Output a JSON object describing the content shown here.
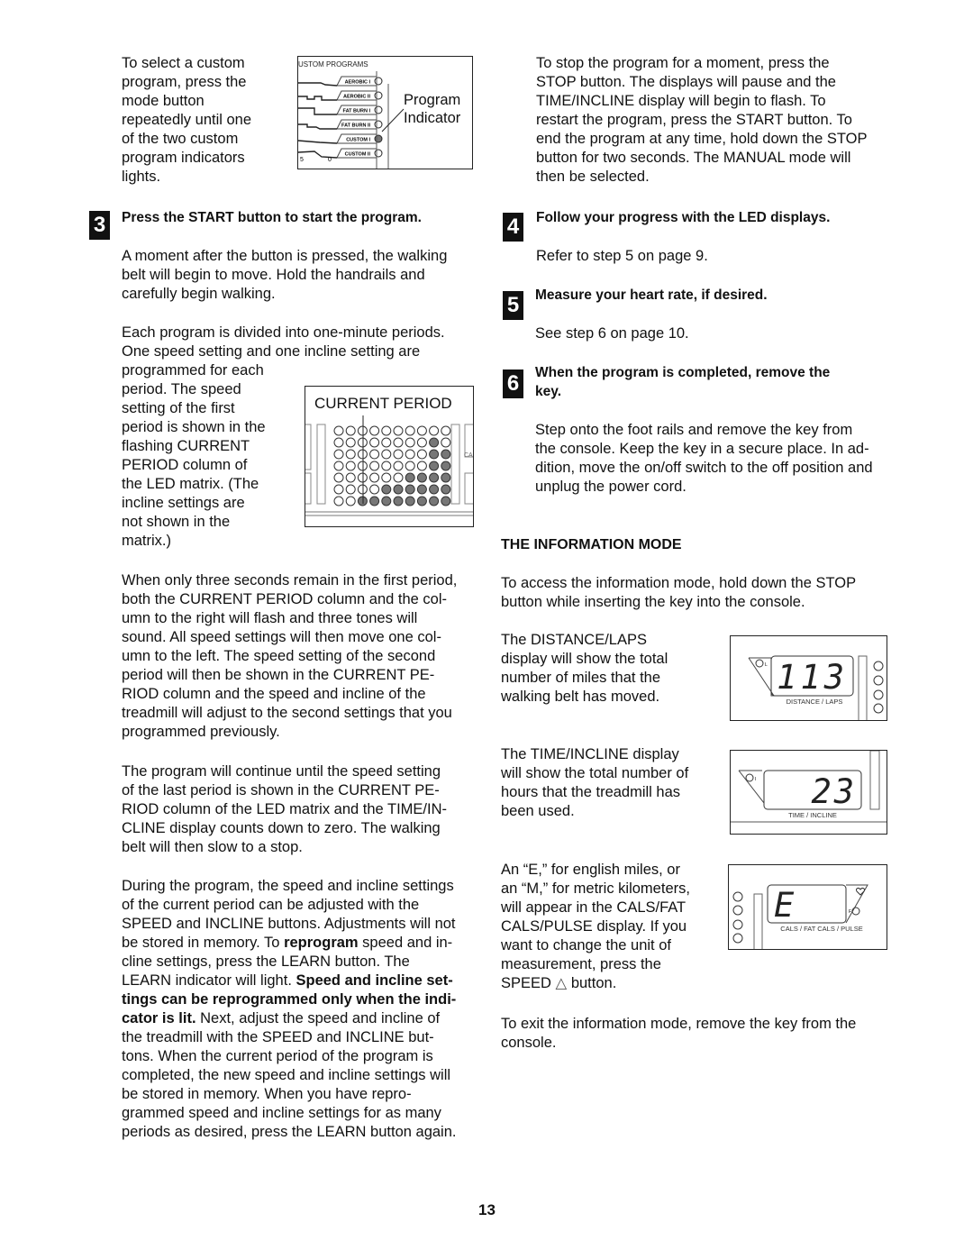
{
  "page": {
    "page_number": "13"
  },
  "left_column": {
    "custom_select_text": "To select a custom program, press the mode button repeatedly until one of the two custom program indicators lights.",
    "custom_select_lines": [
      "To select a custom",
      "program, press the",
      "mode button",
      "repeatedly until one",
      "of the two custom",
      "program indicators",
      "lights."
    ],
    "program_figure": {
      "header": "USTOM PROGRAMS",
      "programs": [
        "AEROBIC I",
        "AEROBIC II",
        "FAT BURN I",
        "FAT BURN II",
        "CUSTOM I",
        "CUSTOM II"
      ],
      "lit_program": "CUSTOM I",
      "callout_line1": "Program",
      "callout_line2": "Indicator",
      "bottom_ticks": [
        "5",
        "0"
      ]
    },
    "step3": {
      "number": "3",
      "title": "Press the START button to start the program.",
      "para1_lines": [
        "A moment after the button is pressed, the walking",
        "belt will begin to move. Hold the handrails and",
        "carefully begin walking."
      ],
      "para2_full_lines": [
        "Each program is divided into one-minute periods.",
        "One speed setting and one incline setting are"
      ],
      "para2_wrap_lines": [
        "programmed for each",
        "period. The speed",
        "setting of the first",
        "period is shown in the",
        "flashing CURRENT",
        "PERIOD column of",
        "the LED matrix. (The",
        "incline settings are",
        "not shown in the",
        "matrix.)"
      ],
      "matrix_figure": {
        "label": "CURRENT PERIOD",
        "side_label": "CA",
        "rows": 7,
        "cols": 10,
        "current_column": 3,
        "filled_heights_by_column": [
          0,
          0,
          1,
          1,
          2,
          2,
          3,
          3,
          6,
          5
        ]
      },
      "para3_lines": [
        "When only three seconds remain in the first period,",
        "both the CURRENT PERIOD column and the col-",
        "umn to the right will flash and three tones will",
        "sound. All speed settings will then move one col-",
        "umn to the left. The speed setting of the second",
        "period will then be shown in the CURRENT PE-",
        "RIOD column and the speed and incline of the",
        "treadmill will adjust to the second settings that you",
        "programmed previously."
      ],
      "para4_lines": [
        "The program will continue until the speed setting",
        "of the last period is shown in the CURRENT PE-",
        "RIOD column of the LED matrix and the TIME/IN-",
        "CLINE display counts down to zero. The walking",
        "belt will then slow to a stop."
      ],
      "para5_lines": [
        {
          "parts": [
            {
              "t": "During the program, the speed and incline settings"
            }
          ]
        },
        {
          "parts": [
            {
              "t": "of the current period can be adjusted with the"
            }
          ]
        },
        {
          "parts": [
            {
              "t": "SPEED and INCLINE buttons. Adjustments will not"
            }
          ]
        },
        {
          "parts": [
            {
              "t": "be stored in memory. To "
            },
            {
              "t": "reprogram",
              "b": true
            },
            {
              "t": " speed and in-"
            }
          ]
        },
        {
          "parts": [
            {
              "t": "cline settings, press the LEARN button. The"
            }
          ]
        },
        {
          "parts": [
            {
              "t": "LEARN indicator will light. "
            },
            {
              "t": "Speed and incline set-",
              "b": true
            }
          ]
        },
        {
          "parts": [
            {
              "t": "tings can be reprogrammed only when the indi-",
              "b": true
            }
          ]
        },
        {
          "parts": [
            {
              "t": "cator is lit.",
              "b": true
            },
            {
              "t": " Next, adjust the speed and incline of"
            }
          ]
        },
        {
          "parts": [
            {
              "t": "the treadmill with the SPEED and INCLINE but-"
            }
          ]
        },
        {
          "parts": [
            {
              "t": "tons. When the current period of the program is"
            }
          ]
        },
        {
          "parts": [
            {
              "t": "completed, the new speed and incline settings will"
            }
          ]
        },
        {
          "parts": [
            {
              "t": "be stored in memory. When you have repro-"
            }
          ]
        },
        {
          "parts": [
            {
              "t": "grammed speed and incline settings for as many"
            }
          ]
        },
        {
          "parts": [
            {
              "t": "periods as desired, press the LEARN button again."
            }
          ]
        }
      ]
    }
  },
  "right_column": {
    "stop_para_lines": [
      "To stop the program for a moment, press the",
      "STOP button. The displays will pause and the",
      "TIME/INCLINE display will begin to flash. To",
      "restart the program, press the START button. To",
      "end the program at any time, hold down the STOP",
      "button for two seconds. The MANUAL mode will",
      "then be selected."
    ],
    "step4": {
      "number": "4",
      "title": "Follow your progress with the LED displays.",
      "body": "Refer to step 5 on page 9."
    },
    "step5": {
      "number": "5",
      "title": "Measure your heart rate, if desired.",
      "body": "See step 6 on page 10."
    },
    "step6": {
      "number": "6",
      "title_line1": "When the program is completed, remove the",
      "title_line2": "key.",
      "body_lines": [
        "Step onto the foot rails and remove the key from",
        "the console. Keep the key in a secure place. In ad-",
        "dition, move the on/off switch to the off position and",
        "unplug the power cord."
      ]
    },
    "information_mode": {
      "title": "THE INFORMATION MODE",
      "intro_lines": [
        "To access the information mode, hold down the STOP",
        "button while inserting the key into the console."
      ],
      "distance_lines": [
        "The DISTANCE/LAPS",
        "display will show the total",
        "number of miles that the",
        "walking belt has moved."
      ],
      "distance_display": {
        "value": "113",
        "label": "DISTANCE / LAPS",
        "indicator": "L"
      },
      "time_lines": [
        "The TIME/INCLINE display",
        "will show the total number of",
        "hours that the treadmill has",
        "been used."
      ],
      "time_display": {
        "value": "23",
        "label": "TIME / INCLINE",
        "indicator": "I"
      },
      "unit_lines": [
        "An “E,” for english miles, or",
        "an “M,” for metric kilometers,",
        "will appear in the CALS/FAT",
        "CALS/PULSE display. If you",
        "want to change the unit of",
        "measurement, press the"
      ],
      "unit_last_line_before": "SPEED",
      "unit_last_line_icon": "△",
      "unit_last_line_after": " button.",
      "cals_display": {
        "value": "E",
        "label": "CALS / FAT CALS / PULSE",
        "indicator": "F"
      },
      "exit_lines": [
        "To exit the information mode, remove the key from the",
        "console."
      ]
    }
  }
}
